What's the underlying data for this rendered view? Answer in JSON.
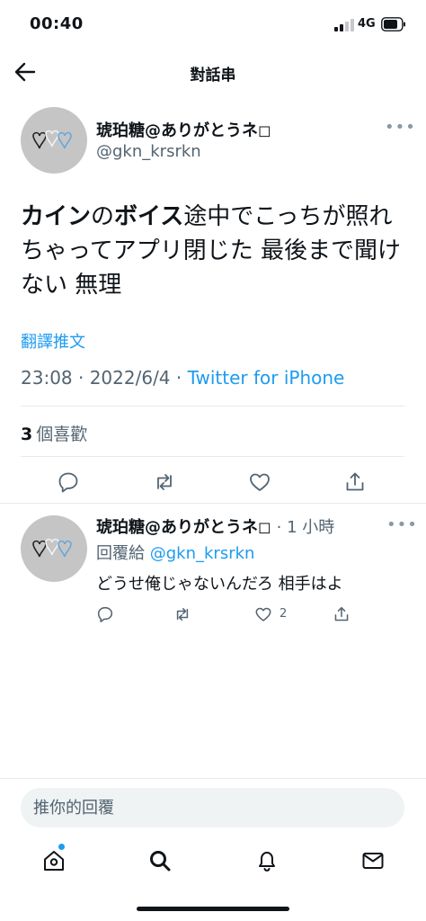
{
  "status_bar": {
    "time": "00:40",
    "network": "4G"
  },
  "header": {
    "title": "對話串"
  },
  "tweet": {
    "author_name": "琥珀糖@ありがとうネ◻",
    "author_handle": "@gkn_krsrkn",
    "text_bold1": "カイン",
    "text_part1": "の",
    "text_bold2": "ボイス",
    "text_part2": "途中でこっちが照れちゃってアプリ閉じた 最後まで聞けない 無理",
    "translate_label": "翻譯推文",
    "timestamp": "23:08 · 2022/6/4 · ",
    "source": "Twitter for iPhone",
    "like_count": "3",
    "like_label": "個喜歡"
  },
  "reply": {
    "author_name": "琥珀糖@ありがとうネ◻",
    "time": " · 1 小時",
    "reply_to_label": "回覆給 ",
    "reply_to_handle": "@gkn_krsrkn",
    "text": "どうせ俺じゃないんだろ 相手はよ",
    "like_count": "2"
  },
  "compose": {
    "placeholder": "推你的回覆"
  },
  "icons": {
    "back": "arrow-left-icon",
    "more": "more-dots-icon",
    "reply": "reply-bubble-icon",
    "retweet": "retweet-icon",
    "like": "heart-icon",
    "share": "share-icon",
    "home": "home-icon",
    "search": "search-icon",
    "notifications": "bell-icon",
    "messages": "mail-icon"
  },
  "colors": {
    "accent": "#1d9bf0",
    "secondary_text": "#536471",
    "divider": "#e6e9ec"
  }
}
